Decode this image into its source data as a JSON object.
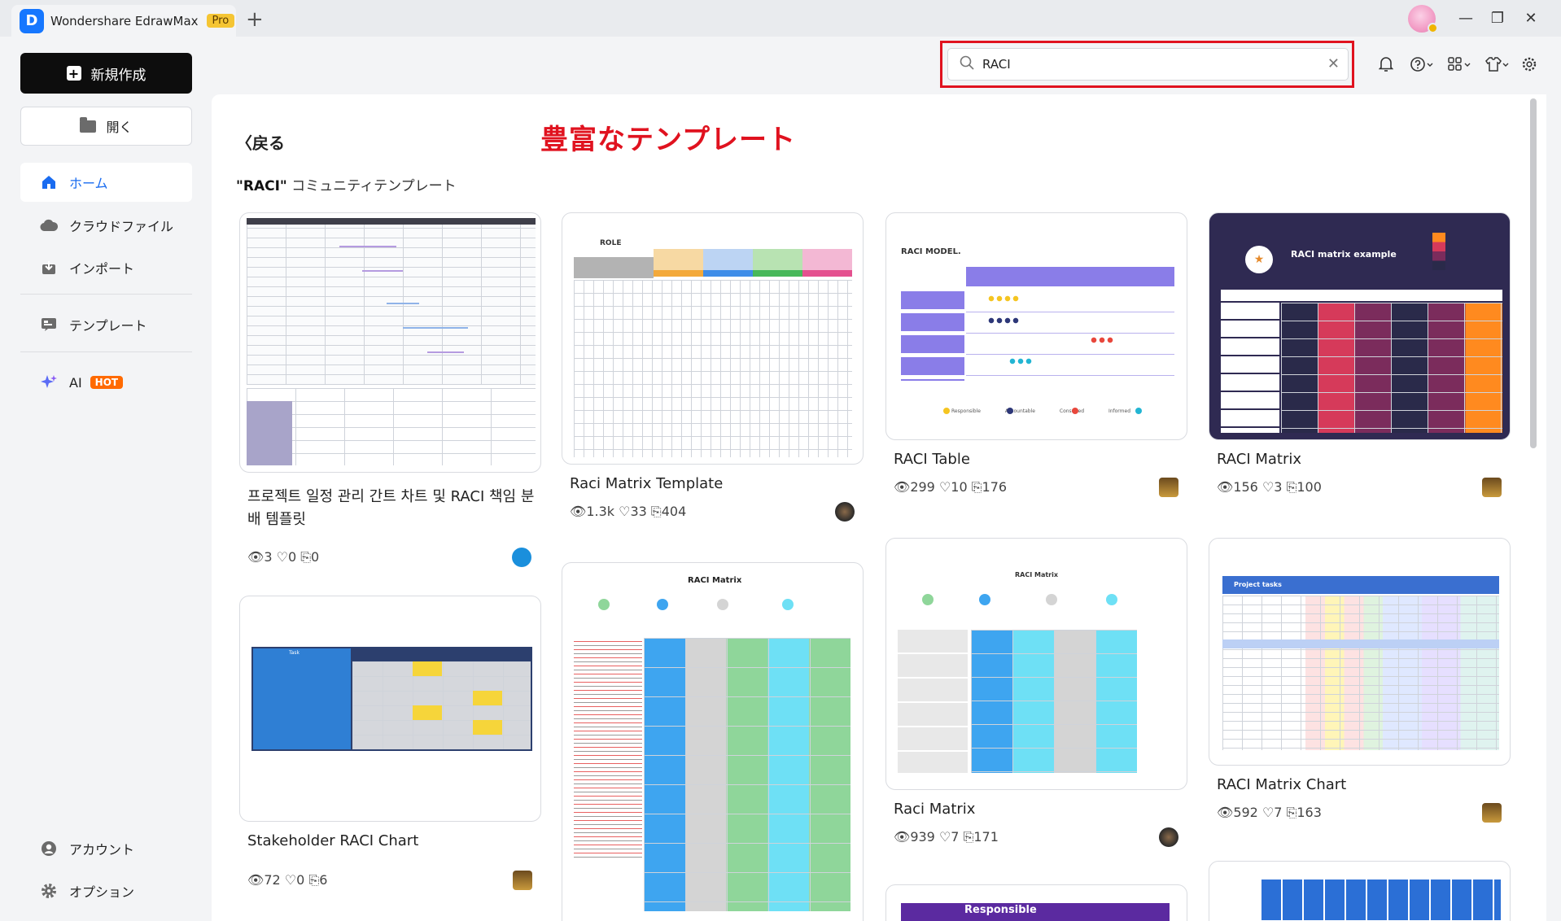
{
  "app": {
    "name": "Wondershare EdrawMax",
    "badge": "Pro",
    "new_tab": "+",
    "logo_letter": "D"
  },
  "window_controls": {
    "minimize": "—",
    "maximize": "❐",
    "close": "✕"
  },
  "sidebar": {
    "new_label": "新規作成",
    "open_label": "開く",
    "items": [
      {
        "label": "ホーム",
        "icon": "home-icon",
        "active": true
      },
      {
        "label": "クラウドファイル",
        "icon": "cloud-icon"
      },
      {
        "label": "インポート",
        "icon": "import-icon"
      },
      {
        "label": "テンプレート",
        "icon": "template-icon"
      },
      {
        "label": "AI",
        "icon": "sparkle-icon",
        "badge": "HOT"
      }
    ],
    "bottom": [
      {
        "label": "アカウント",
        "icon": "account-icon"
      },
      {
        "label": "オプション",
        "icon": "gear-icon"
      }
    ]
  },
  "search": {
    "value": "RACI",
    "clear": "✕"
  },
  "header_icons": [
    "bell-icon",
    "help-icon",
    "apps-icon",
    "shirt-icon",
    "settings-icon"
  ],
  "main": {
    "back_label": "戻る",
    "annotation": "豊富なテンプレート",
    "section_keyword": "\"RACI\"",
    "section_suffix": " コミュニティテンプレート"
  },
  "cards": [
    {
      "title": "프로젝트 일정 관리 간트 차트 및 RACI 책임 분배 템플릿",
      "views": "3",
      "likes": "0",
      "copies": "0"
    },
    {
      "title": "Stakeholder RACI Chart",
      "views": "72",
      "likes": "0",
      "copies": "6"
    },
    {
      "title": "Raci Matrix Template",
      "views": "1.3k",
      "likes": "33",
      "copies": "404"
    },
    {
      "title": "RACI Table",
      "views": "299",
      "likes": "10",
      "copies": "176"
    },
    {
      "title": "Raci Matrix",
      "views": "939",
      "likes": "7",
      "copies": "171"
    },
    {
      "title": "RACI Matrix",
      "views": "156",
      "likes": "3",
      "copies": "100"
    },
    {
      "title": "RACI Matrix Chart",
      "views": "592",
      "likes": "7",
      "copies": "163"
    }
  ],
  "thumb_text": {
    "role": "ROLE",
    "raci_model": "RACI MODEL.",
    "raci_matrix": "RACI Matrix",
    "raci_matrix_example": "RACI matrix example",
    "responsible": "Responsible",
    "accountable": "Accountable",
    "consulted": "Consulted",
    "informed": "Informed",
    "project_tasks": "Project tasks",
    "task": "Task"
  },
  "colors": {
    "accent": "#1a6cf0",
    "highlight": "#e0121f",
    "hot": "#ff6a00"
  }
}
